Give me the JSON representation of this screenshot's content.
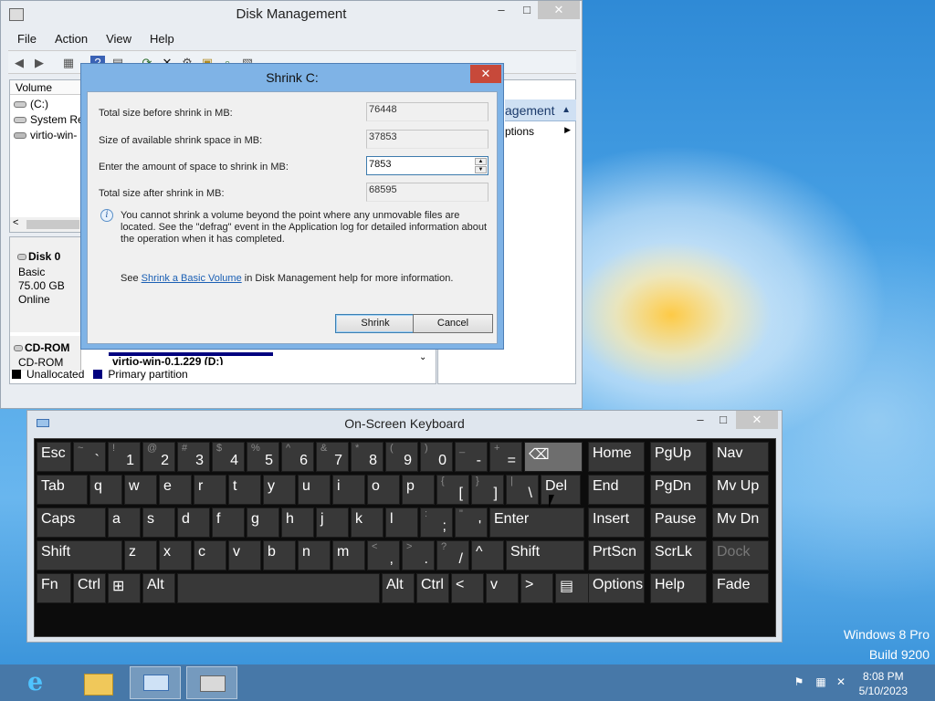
{
  "desktop": {
    "branding_line1": "Windows 8 Pro",
    "branding_line2": "Build 9200"
  },
  "disk_management": {
    "title": "Disk Management",
    "menu": [
      "File",
      "Action",
      "View",
      "Help"
    ],
    "volume_header": "Volume",
    "volumes": [
      "(C:)",
      "System Res",
      "virtio-win-"
    ],
    "actions_label": "agement",
    "actions_more": "ptions",
    "disk0": {
      "name": "Disk 0",
      "type": "Basic",
      "size": "75.00 GB",
      "status": "Online"
    },
    "cdrom": {
      "name": "CD-ROM",
      "type": "CD-ROM",
      "volume_label": "virtio-win-0.1.229  (D:)"
    },
    "legend": {
      "unallocated": "Unallocated",
      "primary": "Primary partition"
    },
    "colors": {
      "unallocated": "#000000",
      "primary": "#00007f"
    }
  },
  "shrink_dialog": {
    "title": "Shrink C:",
    "total_before_label": "Total size before shrink in MB:",
    "total_before_value": "76448",
    "available_label": "Size of available shrink space in MB:",
    "available_value": "37853",
    "amount_label": "Enter the amount of space to shrink in MB:",
    "amount_value": "7853",
    "total_after_label": "Total size after shrink in MB:",
    "total_after_value": "68595",
    "info_text": "You cannot shrink a volume beyond the point where any unmovable files are located. See the \"defrag\" event in the Application log for detailed information about the operation when it has completed.",
    "see_prefix": "See ",
    "see_link": "Shrink a Basic Volume",
    "see_suffix": " in Disk Management help for more information.",
    "shrink_button": "Shrink",
    "cancel_button": "Cancel"
  },
  "osk": {
    "title": "On-Screen Keyboard",
    "rows": {
      "r1": [
        {
          "m": "Esc"
        },
        {
          "s": "~",
          "t": "`"
        },
        {
          "s": "!",
          "t": "1"
        },
        {
          "s": "@",
          "t": "2"
        },
        {
          "s": "#",
          "t": "3"
        },
        {
          "s": "$",
          "t": "4"
        },
        {
          "s": "%",
          "t": "5"
        },
        {
          "s": "^",
          "t": "6"
        },
        {
          "s": "&",
          "t": "7"
        },
        {
          "s": "*",
          "t": "8"
        },
        {
          "s": "(",
          "t": "9"
        },
        {
          "s": ")",
          "t": "0"
        },
        {
          "s": "_",
          "t": "-"
        },
        {
          "s": "+",
          "t": "="
        },
        {
          "m": "⌫"
        }
      ],
      "r2": [
        {
          "m": "Tab"
        },
        {
          "m": "q"
        },
        {
          "m": "w"
        },
        {
          "m": "e"
        },
        {
          "m": "r"
        },
        {
          "m": "t"
        },
        {
          "m": "y"
        },
        {
          "m": "u"
        },
        {
          "m": "i"
        },
        {
          "m": "o"
        },
        {
          "m": "p"
        },
        {
          "s": "{",
          "t": "["
        },
        {
          "s": "}",
          "t": "]"
        },
        {
          "s": "|",
          "t": "\\"
        },
        {
          "m": "Del"
        }
      ],
      "r3": [
        {
          "m": "Caps"
        },
        {
          "m": "a"
        },
        {
          "m": "s"
        },
        {
          "m": "d"
        },
        {
          "m": "f"
        },
        {
          "m": "g"
        },
        {
          "m": "h"
        },
        {
          "m": "j"
        },
        {
          "m": "k"
        },
        {
          "m": "l"
        },
        {
          "s": ":",
          "t": ";"
        },
        {
          "s": "\"",
          "t": "'"
        },
        {
          "m": "Enter"
        }
      ],
      "r4": [
        {
          "m": "Shift"
        },
        {
          "m": "z"
        },
        {
          "m": "x"
        },
        {
          "m": "c"
        },
        {
          "m": "v"
        },
        {
          "m": "b"
        },
        {
          "m": "n"
        },
        {
          "m": "m"
        },
        {
          "s": "<",
          "t": ","
        },
        {
          "s": ">",
          "t": "."
        },
        {
          "s": "?",
          "t": "/"
        },
        {
          "m": "^"
        },
        {
          "m": "Shift"
        }
      ],
      "r5": [
        {
          "m": "Fn"
        },
        {
          "m": "Ctrl"
        },
        {
          "m": "⊞"
        },
        {
          "m": "Alt"
        },
        {
          "m": ""
        },
        {
          "m": "Alt"
        },
        {
          "m": "Ctrl"
        },
        {
          "m": "<"
        },
        {
          "m": "v"
        },
        {
          "m": ">"
        },
        {
          "m": "▤"
        }
      ]
    },
    "nav": [
      [
        "Home",
        "PgUp",
        "Nav"
      ],
      [
        "End",
        "PgDn",
        "Mv Up"
      ],
      [
        "Insert",
        "Pause",
        "Mv Dn"
      ],
      [
        "PrtScn",
        "ScrLk",
        "Dock"
      ],
      [
        "Options",
        "Help",
        "Fade"
      ]
    ]
  },
  "taskbar": {
    "time": "8:08 PM",
    "date": "5/10/2023"
  }
}
